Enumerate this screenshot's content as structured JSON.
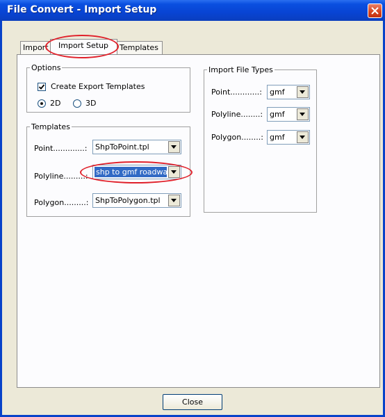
{
  "window": {
    "title": "File Convert - Import Setup"
  },
  "tabs": [
    {
      "label": "Import",
      "active": false
    },
    {
      "label": "Import Setup",
      "active": true
    },
    {
      "label": "Templates",
      "active": false
    }
  ],
  "options": {
    "legend": "Options",
    "create_export_templates": {
      "label": "Create Export Templates",
      "checked": true
    },
    "dimension": {
      "options": [
        "2D",
        "3D"
      ],
      "selected": "2D"
    }
  },
  "templates": {
    "legend": "Templates",
    "rows": [
      {
        "label": "Point.............:",
        "value": "ShpToPoint.tpl"
      },
      {
        "label": "Polyline.........:",
        "value": "shp to gmf roadway"
      },
      {
        "label": "Polygon.........:",
        "value": "ShpToPolygon.tpl"
      }
    ]
  },
  "import_file_types": {
    "legend": "Import File Types",
    "rows": [
      {
        "label": "Point............:",
        "value": "gmf"
      },
      {
        "label": "Polyline........:",
        "value": "gmf"
      },
      {
        "label": "Polygon........:",
        "value": "gmf"
      }
    ]
  },
  "close_label": "Close",
  "colors": {
    "titlebar": "#0a4fe0",
    "annotation": "#e0202a",
    "selection": "#316ac5"
  }
}
